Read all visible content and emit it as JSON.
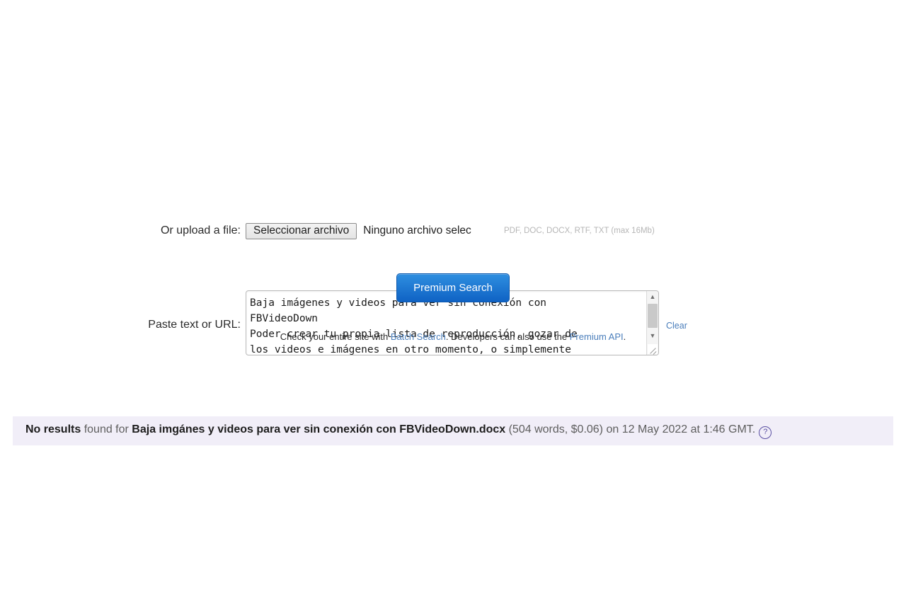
{
  "form": {
    "paste_label": "Paste text or URL:",
    "textarea_value": "Baja imágenes y videos para ver sin conexión con\nFBVideoDown\nPoder crear tu propia lista de reproducción, gozar de\nlos videos e imágenes en otro momento, o simplemente",
    "clear_link": "Clear",
    "upload_label": "Or upload a file:",
    "file_button": "Seleccionar archivo",
    "file_name": "Ninguno archivo selec",
    "file_hint": "PDF, DOC, DOCX, RTF, TXT (max 16Mb)",
    "submit_button": "Premium Search",
    "scroll_up_icon": "scroll-up-arrow",
    "scroll_down_icon": "scroll-down-arrow"
  },
  "footer": {
    "text_before": "Check your entire site with ",
    "batch_link": "Batch Search",
    "text_middle": ". Developers can also use the ",
    "api_link": "Premium API",
    "text_after": "."
  },
  "result": {
    "status": "No results",
    "found_for": " found for ",
    "document_name": "Baja imgánes y videos para ver sin conexión con FBVideoDown.docx",
    "meta": " (504 words, $0.06) on 12 May 2022 at 1:46 GMT.",
    "help_icon": "?"
  },
  "colors": {
    "accent_blue": "#0f62c4",
    "link_blue": "#4a7ebb",
    "result_bar_bg": "#f1eef8",
    "help_icon_purple": "#5a4fa3",
    "hint_gray": "#b6b6b6"
  }
}
